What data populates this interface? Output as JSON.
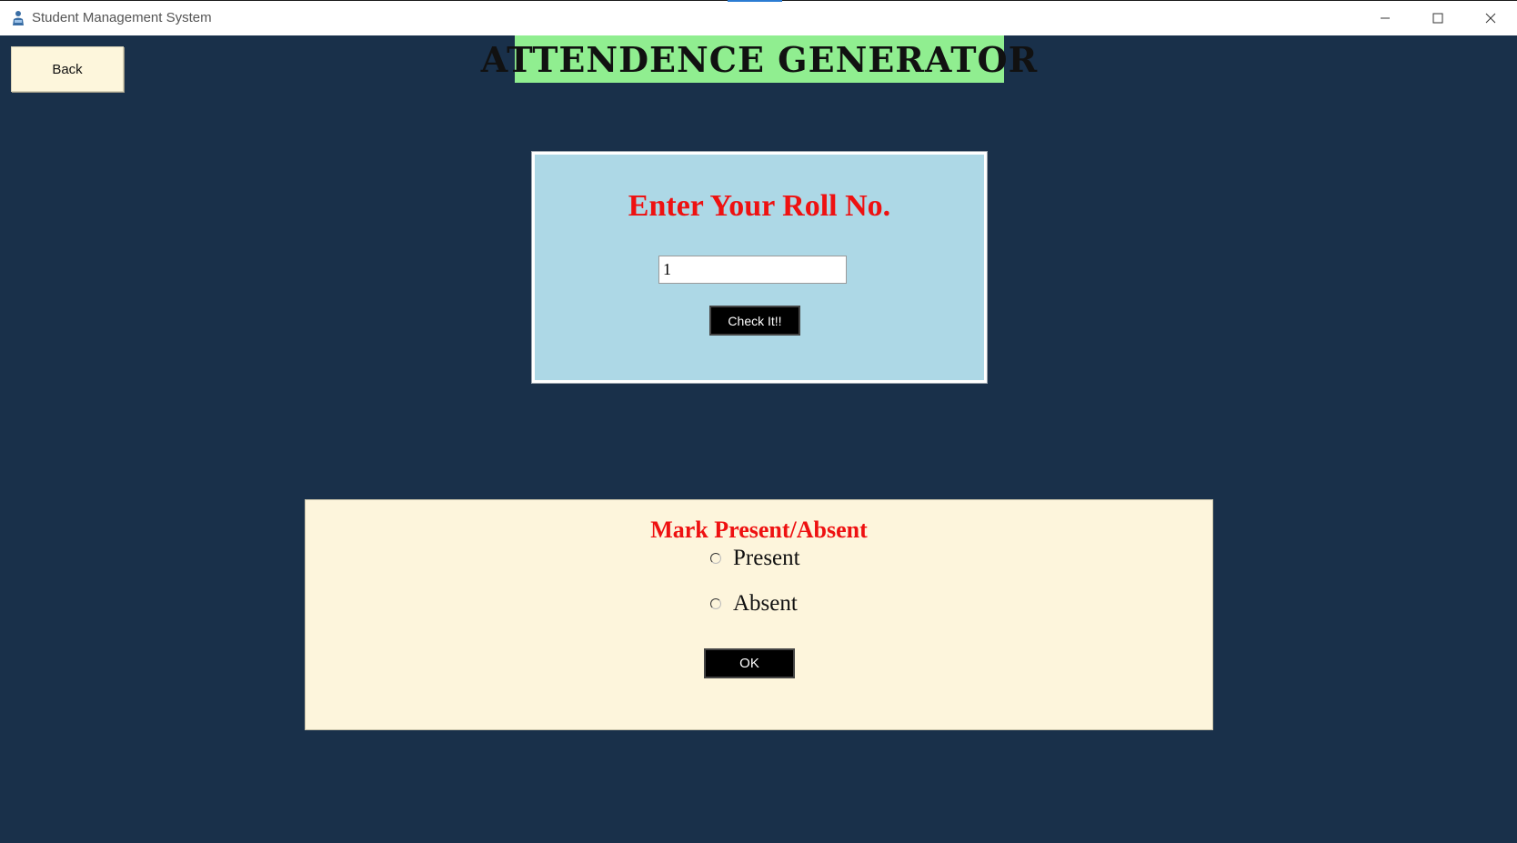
{
  "window": {
    "title": "Student Management System",
    "app_icon": "student-person-icon",
    "controls": {
      "minimize_icon": "minimize-icon",
      "maximize_icon": "maximize-icon",
      "close_icon": "close-icon"
    }
  },
  "colors": {
    "background": "#19304a",
    "title_banner": "#90ee90",
    "roll_panel": "#add8e6",
    "mark_panel": "#fdf5dc",
    "heading_red": "#ee1111",
    "button_black": "#000000",
    "back_button": "#fdf6dc"
  },
  "toolbar": {
    "back_label": "Back"
  },
  "header": {
    "title": "ATTENDENCE GENERATOR"
  },
  "roll_panel": {
    "heading": "Enter Your Roll No.",
    "input_value": "1",
    "check_label": "Check It!!"
  },
  "mark_panel": {
    "heading": "Mark Present/Absent",
    "options": [
      {
        "label": "Present",
        "selected": false
      },
      {
        "label": "Absent",
        "selected": false
      }
    ],
    "ok_label": "OK"
  }
}
